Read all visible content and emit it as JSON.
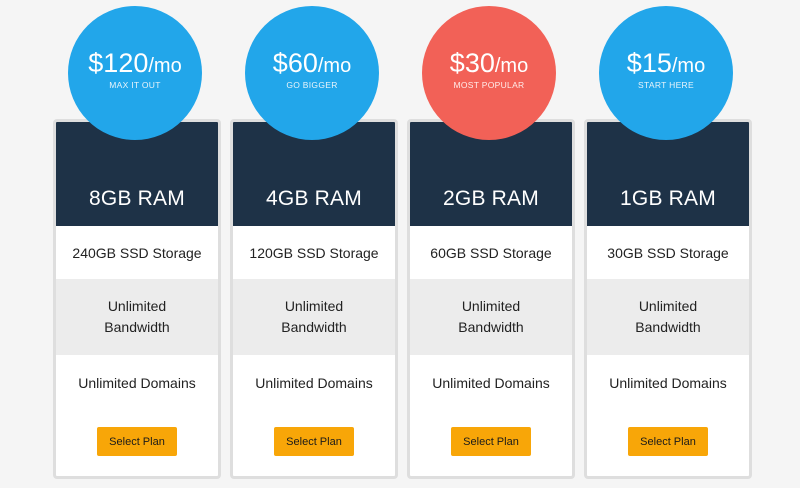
{
  "plans": [
    {
      "price": "$120",
      "per": "/mo",
      "tagline": "MAX IT OUT",
      "color": "#22a6ea",
      "ram": "8GB RAM",
      "storage": "240GB SSD Storage",
      "bandwidth": "Unlimited Bandwidth",
      "domains": "Unlimited Domains",
      "button": "Select Plan"
    },
    {
      "price": "$60",
      "per": "/mo",
      "tagline": "GO BIGGER",
      "color": "#22a6ea",
      "ram": "4GB RAM",
      "storage": "120GB SSD Storage",
      "bandwidth": "Unlimited Bandwidth",
      "domains": "Unlimited Domains",
      "button": "Select Plan"
    },
    {
      "price": "$30",
      "per": "/mo",
      "tagline": "MOST POPULAR",
      "color": "#f26157",
      "ram": "2GB RAM",
      "storage": "60GB SSD Storage",
      "bandwidth": "Unlimited Bandwidth",
      "domains": "Unlimited Domains",
      "button": "Select Plan"
    },
    {
      "price": "$15",
      "per": "/mo",
      "tagline": "START HERE",
      "color": "#22a6ea",
      "ram": "1GB RAM",
      "storage": "30GB SSD Storage",
      "bandwidth": "Unlimited Bandwidth",
      "domains": "Unlimited Domains",
      "button": "Select Plan"
    }
  ],
  "colors": {
    "header_bg": "#1e3247",
    "button_bg": "#f8a608",
    "stripe_bg": "#ececec",
    "card_border": "#dedede"
  }
}
